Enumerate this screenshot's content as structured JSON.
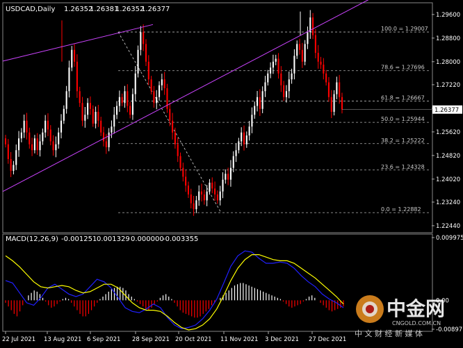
{
  "price_header": {
    "symbol": "USDCAD,Daily",
    "ohlc": [
      "1.26352",
      "1.26381",
      "1.26352",
      "1.26377"
    ]
  },
  "macd_header": {
    "label": "MACD(12,26,9)",
    "values": [
      "-0.001251",
      "0.001329",
      "0.000000",
      "-0.003355"
    ]
  },
  "colors": {
    "background": "#000000",
    "bull_candle": "#ffffff",
    "bear_candle": "#ff0000",
    "channel": "#cc44ff",
    "fib_lines": "#b4b4b4",
    "macd_main": "#2020ff",
    "macd_signal": "#ffff00",
    "hist_positive": "#ffffff",
    "hist_negative": "#ff0000",
    "current_price_box": "#ffffff"
  },
  "watermark": {
    "name_cn": "中金网",
    "url": "CNGOLD.COM.CN",
    "tagline": "中 文 财 经 新 媒 体"
  },
  "chart_data": [
    {
      "type": "candlestick",
      "title": "USDCAD,Daily",
      "ylim": [
        1.2225,
        1.2995
      ],
      "y_ticks": [
        "1.29600",
        "1.28800",
        "1.28000",
        "1.27220",
        "1.26420",
        "1.25620",
        "1.24820",
        "1.24020",
        "1.23240",
        "1.22440"
      ],
      "current_price": "1.26377",
      "x_ticks": [
        "22 Jul 2021",
        "13 Aug 2021",
        "6 Sep 2021",
        "28 Sep 2021",
        "20 Oct 2021",
        "11 Nov 2021",
        "3 Dec 2021",
        "27 Dec 2021"
      ],
      "fibonacci": [
        {
          "label": "100.0 = 1.29007",
          "value": 1.29007
        },
        {
          "label": "78.6 = 1.27696",
          "value": 1.27696
        },
        {
          "label": "61.8 = 1.26667",
          "value": 1.26667
        },
        {
          "label": "50.0 = 1.25944",
          "value": 1.25944
        },
        {
          "label": "38.2 = 1.25222",
          "value": 1.25222
        },
        {
          "label": "23.6 = 1.24328",
          "value": 1.24328
        },
        {
          "label": "0.0 = 1.22882",
          "value": 1.22882
        }
      ],
      "closes": [
        1.252,
        1.247,
        1.243,
        1.245,
        1.25,
        1.254,
        1.256,
        1.26,
        1.256,
        1.252,
        1.25,
        1.254,
        1.25,
        1.253,
        1.256,
        1.26,
        1.257,
        1.253,
        1.25,
        1.252,
        1.256,
        1.26,
        1.264,
        1.27,
        1.278,
        1.284,
        1.28,
        1.27,
        1.266,
        1.26,
        1.262,
        1.266,
        1.264,
        1.259,
        1.263,
        1.26,
        1.256,
        1.253,
        1.251,
        1.256,
        1.258,
        1.262,
        1.265,
        1.268,
        1.266,
        1.27,
        1.265,
        1.262,
        1.269,
        1.276,
        1.284,
        1.29,
        1.286,
        1.28,
        1.274,
        1.27,
        1.266,
        1.268,
        1.272,
        1.274,
        1.271,
        1.264,
        1.26,
        1.256,
        1.252,
        1.248,
        1.244,
        1.241,
        1.238,
        1.235,
        1.232,
        1.23,
        1.233,
        1.236,
        1.235,
        1.233,
        1.236,
        1.239,
        1.237,
        1.235,
        1.233,
        1.236,
        1.24,
        1.242,
        1.24,
        1.244,
        1.248,
        1.25,
        1.253,
        1.256,
        1.252,
        1.255,
        1.258,
        1.262,
        1.265,
        1.268,
        1.264,
        1.27,
        1.273,
        1.276,
        1.278,
        1.28,
        1.281,
        1.276,
        1.272,
        1.268,
        1.27,
        1.274,
        1.276,
        1.282,
        1.286,
        1.284,
        1.28,
        1.286,
        1.29,
        1.295,
        1.289,
        1.283,
        1.28,
        1.279,
        1.276,
        1.273,
        1.268,
        1.263,
        1.269,
        1.273,
        1.268,
        1.2638
      ],
      "channel_upper": [
        [
          0,
          1.2802
        ],
        [
          220,
          1.2926
        ]
      ],
      "channel_lower": [
        [
          0,
          1.236
        ],
        [
          530,
          1.301
        ]
      ]
    },
    {
      "type": "macd",
      "title": "MACD(12,26,9)",
      "ylim": [
        -0.0048,
        0.0105
      ],
      "y_ticks": [
        "0.009975",
        "0.00",
        "-0.008971"
      ],
      "macd_line": [
        0.0032,
        0.0028,
        0.0012,
        -0.0004,
        -0.0008,
        0.0004,
        0.002,
        0.0026,
        0.0018,
        0.001,
        0.0006,
        0.001,
        0.0022,
        0.0034,
        0.003,
        0.002,
        0.0004,
        -0.0012,
        -0.0018,
        -0.002,
        -0.0014,
        -0.0006,
        -0.0012,
        -0.0028,
        -0.004,
        -0.0046,
        -0.0044,
        -0.004,
        -0.003,
        -0.0016,
        0.0002,
        0.0028,
        0.0055,
        0.0072,
        0.008,
        0.0078,
        0.0068,
        0.006,
        0.006,
        0.0062,
        0.006,
        0.0052,
        0.004,
        0.003,
        0.0022,
        0.001,
        0.0002,
        -0.0004,
        -0.0012
      ],
      "signal_line": [
        0.0072,
        0.0064,
        0.0054,
        0.0042,
        0.003,
        0.0022,
        0.002,
        0.0022,
        0.0024,
        0.0022,
        0.0016,
        0.0012,
        0.0014,
        0.002,
        0.0026,
        0.0026,
        0.002,
        0.0008,
        -0.0004,
        -0.0012,
        -0.0016,
        -0.0016,
        -0.0018,
        -0.0026,
        -0.0036,
        -0.0044,
        -0.0048,
        -0.0046,
        -0.004,
        -0.003,
        -0.0014,
        0.0008,
        0.0032,
        0.0052,
        0.0066,
        0.0074,
        0.0074,
        0.007,
        0.0066,
        0.0064,
        0.0064,
        0.006,
        0.0052,
        0.0044,
        0.0036,
        0.0026,
        0.0016,
        0.0006,
        -0.0006
      ],
      "histogram": [
        -0.0004,
        -0.001,
        -0.0016,
        -0.0022,
        -0.0026,
        -0.0018,
        -0.0008,
        0.0,
        0.0008,
        0.0012,
        0.0016,
        0.0014,
        0.001,
        0.0004,
        -0.0002,
        -0.0008,
        -0.0012,
        -0.001,
        -0.0006,
        -0.0002,
        0.0002,
        0.0004,
        0.0002,
        -0.0004,
        -0.001,
        -0.0016,
        -0.0022,
        -0.0026,
        -0.0026,
        -0.0022,
        -0.0016,
        -0.001,
        -0.0004,
        0.0002,
        0.0006,
        0.001,
        0.0014,
        0.0018,
        0.002,
        0.0022,
        0.0022,
        0.002,
        0.0016,
        0.001,
        0.0006,
        0.0002,
        -0.0002,
        -0.0006,
        -0.001,
        -0.0014,
        -0.0016,
        -0.0012,
        -0.0006,
        -0.0002,
        0.0004,
        0.0008,
        0.001,
        0.0006,
        0.0002,
        -0.0004,
        -0.001,
        -0.0016,
        -0.002,
        -0.0022,
        -0.0024,
        -0.0026,
        -0.0028,
        -0.0028,
        -0.0026,
        -0.0022,
        -0.0018,
        -0.0014,
        -0.0008,
        -0.0004,
        0.0,
        0.0004,
        0.0008,
        0.0012,
        0.0016,
        0.002,
        0.0024,
        0.0026,
        0.0028,
        0.0028,
        0.0026,
        0.0024,
        0.0022,
        0.002,
        0.0018,
        0.0016,
        0.0014,
        0.0012,
        0.001,
        0.0008,
        0.0006,
        0.0004,
        0.0002,
        -0.0002,
        -0.0006,
        -0.001,
        -0.0012,
        -0.001,
        -0.0008,
        -0.0006,
        -0.0002,
        0.0002,
        0.0006,
        0.0008,
        0.0004,
        0.0,
        -0.0004,
        -0.0008,
        -0.0012,
        -0.0016,
        -0.0018,
        -0.0016,
        -0.0014,
        -0.0012,
        -0.001
      ]
    }
  ]
}
